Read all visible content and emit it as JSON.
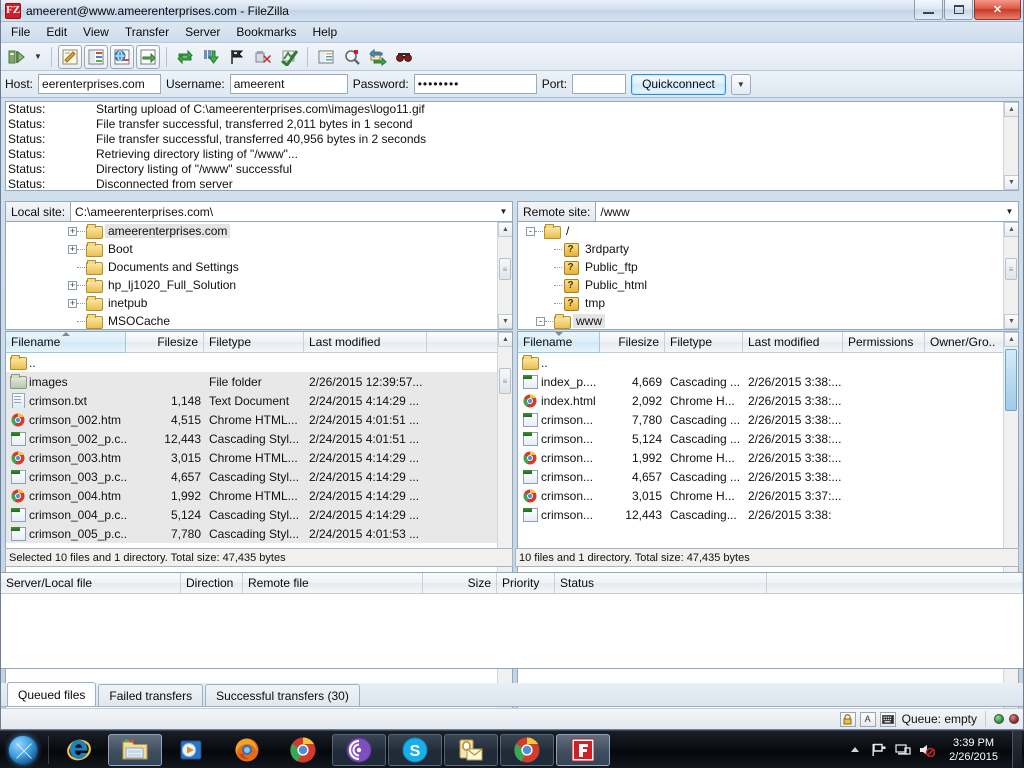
{
  "window": {
    "title": "ameerent@www.ameerenterprises.com - FileZilla",
    "app_icon": "filezilla-icon",
    "minimize_label": "Minimize",
    "maximize_label": "Maximize",
    "close_label": "Close"
  },
  "menu": {
    "items": [
      {
        "label": "File"
      },
      {
        "label": "Edit"
      },
      {
        "label": "View"
      },
      {
        "label": "Transfer"
      },
      {
        "label": "Server"
      },
      {
        "label": "Bookmarks"
      },
      {
        "label": "Help"
      }
    ]
  },
  "toolbar": {
    "buttons": [
      {
        "name": "site-manager-icon",
        "title": "Open the Site Manager"
      },
      {
        "name": "site-manager-dropdown-icon",
        "title": "Site Manager dropdown"
      },
      {
        "name": "toggle-message-log-icon",
        "title": "Toggles the display of the message log"
      },
      {
        "name": "toggle-local-tree-icon",
        "title": "Toggles the display of the local directory tree"
      },
      {
        "name": "toggle-remote-tree-icon",
        "title": "Toggles the display of the remote directory tree"
      },
      {
        "name": "toggle-transfer-queue-icon",
        "title": "Toggles the display of the transfer queue"
      },
      {
        "name": "refresh-icon",
        "title": "Refresh the file and folder lists"
      },
      {
        "name": "process-queue-icon",
        "title": "Process queue"
      },
      {
        "name": "toggle-filter-icon",
        "title": "Toggle filters"
      },
      {
        "name": "cancel-operation-icon",
        "title": "Cancel current operation"
      },
      {
        "name": "disconnect-icon",
        "title": "Disconnects from the currently visible server"
      },
      {
        "name": "directory-comparison-icon",
        "title": "Directory comparison"
      },
      {
        "name": "synchronized-browsing-icon",
        "title": "Synchronized browsing"
      },
      {
        "name": "find-files-icon",
        "title": "Search remote files"
      },
      {
        "name": "reconnect-icon",
        "title": "Reconnect"
      }
    ]
  },
  "quickconnect": {
    "host_label": "Host:",
    "host_value": "eerenterprises.com",
    "username_label": "Username:",
    "username_value": "ameerent",
    "password_label": "Password:",
    "password_value": "••••••••",
    "port_label": "Port:",
    "port_value": "",
    "button_label": "Quickconnect",
    "dropdown_icon": "chevron-down-icon"
  },
  "log": {
    "prefix": "Status:",
    "entries": [
      {
        "label": "Status:",
        "message": "Starting upload of C:\\ameerenterprises.com\\images\\logo11.gif"
      },
      {
        "label": "Status:",
        "message": "File transfer successful, transferred 2,011 bytes in 1 second"
      },
      {
        "label": "Status:",
        "message": "File transfer successful, transferred 40,956 bytes in 2 seconds"
      },
      {
        "label": "Status:",
        "message": "Retrieving directory listing of \"/www\"..."
      },
      {
        "label": "Status:",
        "message": "Directory listing of \"/www\" successful"
      },
      {
        "label": "Status:",
        "message": "Disconnected from server"
      }
    ]
  },
  "local": {
    "site_label": "Local site:",
    "site_value": "C:\\ameerenterprises.com\\",
    "tree": [
      {
        "label": "ameerenterprises.com",
        "expander": "+",
        "selected": true,
        "icon": "folder-icon"
      },
      {
        "label": "Boot",
        "expander": "+",
        "selected": false,
        "icon": "folder-icon"
      },
      {
        "label": "Documents and Settings",
        "expander": "",
        "selected": false,
        "icon": "folder-icon"
      },
      {
        "label": "hp_lj1020_Full_Solution",
        "expander": "+",
        "selected": false,
        "icon": "folder-icon"
      },
      {
        "label": "inetpub",
        "expander": "+",
        "selected": false,
        "icon": "folder-icon"
      },
      {
        "label": "MSOCache",
        "expander": "",
        "selected": false,
        "icon": "folder-icon"
      }
    ],
    "columns": [
      {
        "label": "Filename",
        "sorted": true,
        "sort_dir": "up"
      },
      {
        "label": "Filesize",
        "align": "right"
      },
      {
        "label": "Filetype",
        "align": "left"
      },
      {
        "label": "Last modified",
        "align": "left"
      }
    ],
    "rows": [
      {
        "name": "..",
        "size": "",
        "type": "",
        "modified": "",
        "icon": "folder-icon",
        "selected": false
      },
      {
        "name": "images",
        "size": "",
        "type": "File folder",
        "modified": "2/26/2015 12:39:57...",
        "icon": "folder-gray-icon",
        "selected": true
      },
      {
        "name": "crimson.txt",
        "size": "1,148",
        "type": "Text Document",
        "modified": "2/24/2015 4:14:29 ...",
        "icon": "text-file-icon",
        "selected": true
      },
      {
        "name": "crimson_002.htm",
        "size": "4,515",
        "type": "Chrome HTML...",
        "modified": "2/24/2015 4:01:51 ...",
        "icon": "chrome-html-icon",
        "selected": true
      },
      {
        "name": "crimson_002_p.c...",
        "size": "12,443",
        "type": "Cascading Styl...",
        "modified": "2/24/2015 4:01:51 ...",
        "icon": "css-file-icon",
        "selected": true
      },
      {
        "name": "crimson_003.htm",
        "size": "3,015",
        "type": "Chrome HTML...",
        "modified": "2/24/2015 4:14:29 ...",
        "icon": "chrome-html-icon",
        "selected": true
      },
      {
        "name": "crimson_003_p.c...",
        "size": "4,657",
        "type": "Cascading Styl...",
        "modified": "2/24/2015 4:14:29 ...",
        "icon": "css-file-icon",
        "selected": true
      },
      {
        "name": "crimson_004.htm",
        "size": "1,992",
        "type": "Chrome HTML...",
        "modified": "2/24/2015 4:14:29 ...",
        "icon": "chrome-html-icon",
        "selected": true
      },
      {
        "name": "crimson_004_p.c...",
        "size": "5,124",
        "type": "Cascading Styl...",
        "modified": "2/24/2015 4:14:29 ...",
        "icon": "css-file-icon",
        "selected": true
      },
      {
        "name": "crimson_005_p.c...",
        "size": "7,780",
        "type": "Cascading Styl...",
        "modified": "2/24/2015 4:01:53 ...",
        "icon": "css-file-icon",
        "selected": true
      }
    ],
    "status": "Selected 10 files and 1 directory. Total size: 47,435 bytes"
  },
  "remote": {
    "site_label": "Remote site:",
    "site_value": "/www",
    "tree": [
      {
        "label": "/",
        "expander": "-",
        "selected": false,
        "icon": "folder-icon",
        "depth": 0
      },
      {
        "label": "3rdparty",
        "expander": "",
        "selected": false,
        "icon": "unknown-folder-icon",
        "depth": 1
      },
      {
        "label": "Public_ftp",
        "expander": "",
        "selected": false,
        "icon": "unknown-folder-icon",
        "depth": 1
      },
      {
        "label": "Public_html",
        "expander": "",
        "selected": false,
        "icon": "unknown-folder-icon",
        "depth": 1
      },
      {
        "label": "tmp",
        "expander": "",
        "selected": false,
        "icon": "unknown-folder-icon",
        "depth": 1
      },
      {
        "label": "www",
        "expander": "-",
        "selected": true,
        "icon": "folder-icon",
        "depth": 1
      }
    ],
    "columns": [
      {
        "label": "Filename",
        "sorted": true,
        "sort_dir": "down"
      },
      {
        "label": "Filesize",
        "align": "right"
      },
      {
        "label": "Filetype",
        "align": "left"
      },
      {
        "label": "Last modified",
        "align": "left"
      },
      {
        "label": "Permissions",
        "align": "left"
      },
      {
        "label": "Owner/Gro..",
        "align": "left"
      }
    ],
    "rows": [
      {
        "name": "..",
        "size": "",
        "type": "",
        "modified": "",
        "icon": "folder-icon"
      },
      {
        "name": "index_p....",
        "size": "4,669",
        "type": "Cascading ...",
        "modified": "2/26/2015 3:38:...",
        "icon": "css-file-icon"
      },
      {
        "name": "index.html",
        "size": "2,092",
        "type": "Chrome H...",
        "modified": "2/26/2015 3:38:...",
        "icon": "chrome-html-icon"
      },
      {
        "name": "crimson...",
        "size": "7,780",
        "type": "Cascading ...",
        "modified": "2/26/2015 3:38:...",
        "icon": "css-file-icon"
      },
      {
        "name": "crimson...",
        "size": "5,124",
        "type": "Cascading ...",
        "modified": "2/26/2015 3:38:...",
        "icon": "css-file-icon"
      },
      {
        "name": "crimson...",
        "size": "1,992",
        "type": "Chrome H...",
        "modified": "2/26/2015 3:38:...",
        "icon": "chrome-html-icon"
      },
      {
        "name": "crimson...",
        "size": "4,657",
        "type": "Cascading ...",
        "modified": "2/26/2015 3:38:...",
        "icon": "css-file-icon"
      },
      {
        "name": "crimson...",
        "size": "3,015",
        "type": "Chrome H...",
        "modified": "2/26/2015 3:37:...",
        "icon": "chrome-html-icon"
      },
      {
        "name": "crimson...",
        "size": "12,443",
        "type": "Cascading...",
        "modified": "2/26/2015 3:38:",
        "icon": "css-file-icon"
      }
    ],
    "status": "10 files and 1 directory. Total size: 47,435 bytes"
  },
  "queue": {
    "columns": [
      {
        "label": "Server/Local file",
        "align": "left"
      },
      {
        "label": "Direction",
        "align": "left"
      },
      {
        "label": "Remote file",
        "align": "left"
      },
      {
        "label": "Size",
        "align": "right"
      },
      {
        "label": "Priority",
        "align": "left"
      },
      {
        "label": "Status",
        "align": "left"
      }
    ],
    "rows": []
  },
  "tabs": [
    {
      "label": "Queued files",
      "active": true
    },
    {
      "label": "Failed transfers",
      "active": false
    },
    {
      "label": "Successful transfers (30)",
      "active": false
    }
  ],
  "statusbar": {
    "icons": [
      {
        "name": "lock-icon"
      },
      {
        "name": "ascii-transfer-icon"
      },
      {
        "name": "keyboard-icon"
      }
    ],
    "queue_text": "Queue: empty",
    "led_green": "#2f8b35",
    "led_red": "#8b2020"
  },
  "taskbar": {
    "start_label": "Start",
    "items": [
      {
        "name": "internet-explorer-icon",
        "state": "quicklaunch"
      },
      {
        "name": "windows-explorer-icon",
        "state": "active"
      },
      {
        "name": "windows-media-player-icon",
        "state": "quicklaunch"
      },
      {
        "name": "firefox-icon",
        "state": "quicklaunch"
      },
      {
        "name": "chrome-icon",
        "state": "quicklaunch"
      },
      {
        "name": "bittorrent-icon",
        "state": "running"
      },
      {
        "name": "skype-icon",
        "state": "running"
      },
      {
        "name": "outlook-icon",
        "state": "running"
      },
      {
        "name": "chrome-window-icon",
        "state": "running"
      },
      {
        "name": "filezilla-icon",
        "state": "active"
      }
    ],
    "tray": [
      {
        "name": "show-hidden-icons-icon"
      },
      {
        "name": "action-center-flag-icon"
      },
      {
        "name": "network-icon"
      },
      {
        "name": "volume-muted-icon"
      }
    ],
    "clock_time": "3:39 PM",
    "clock_date": "2/26/2015"
  },
  "colors": {
    "accent": "#2f8fd4",
    "title_red": "#cf2027",
    "selection": "#e8e8e8",
    "pane_border": "#93a7bb"
  }
}
